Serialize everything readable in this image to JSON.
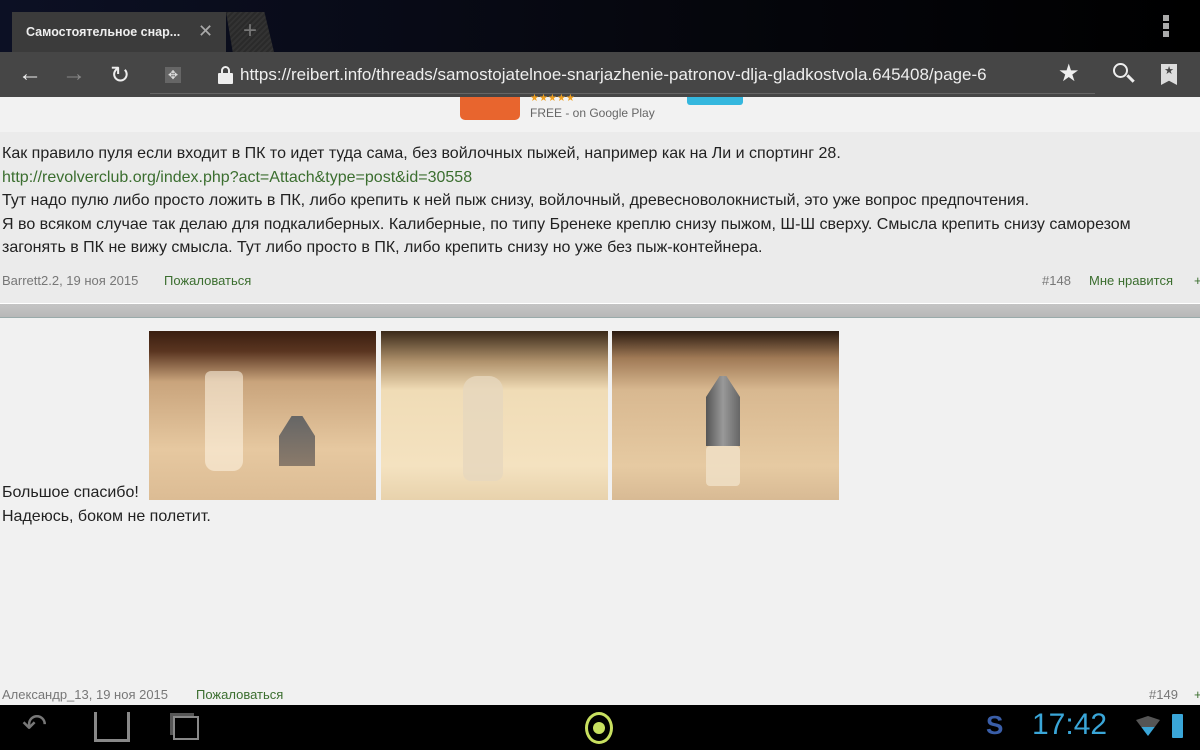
{
  "browser": {
    "tab_title": "Самостоятельное снар...",
    "url": "https://reibert.info/threads/samostojatelnoe-snarjazhenie-patronov-dlja-gladkostvola.645408/page-6"
  },
  "ad": {
    "stars": "★★★★★",
    "text": "FREE - on Google Play"
  },
  "posts": [
    {
      "lines": [
        "Как правило пуля если входит в ПК то идет туда сама, без войлочных пыжей, например как на Ли и спортинг 28.",
        "Тут надо пулю либо просто ложить в ПК, либо крепить к ней пыж снизу, войлочный, древесноволокнистый, это уже вопрос предпочтения.",
        "Я во всяком случае так делаю для подкалиберных. Калиберные, по типу Бренеке креплю снизу пыжом, Ш-Ш сверху. Смысла крепить снизу саморезом",
        "загонять в ПК не вижу смысла. Тут либо просто в ПК, либо крепить снизу но уже без пыж-контейнера."
      ],
      "link": "http://revolverclub.org/index.php?act=Attach&type=post&id=30558",
      "author_date": "Barrett2.2, 19 ноя 2015",
      "report": "Пожаловаться",
      "number": "#148",
      "like": "Мне нравится",
      "plus": "+"
    },
    {
      "lines": [
        "Большое спасибо!",
        "Надеюсь, боком не полетит."
      ],
      "author_date": "Александр_13, 19 ноя 2015",
      "report": "Пожаловаться",
      "number": "#149",
      "plus": "+"
    }
  ],
  "status": {
    "time": "17:42"
  }
}
